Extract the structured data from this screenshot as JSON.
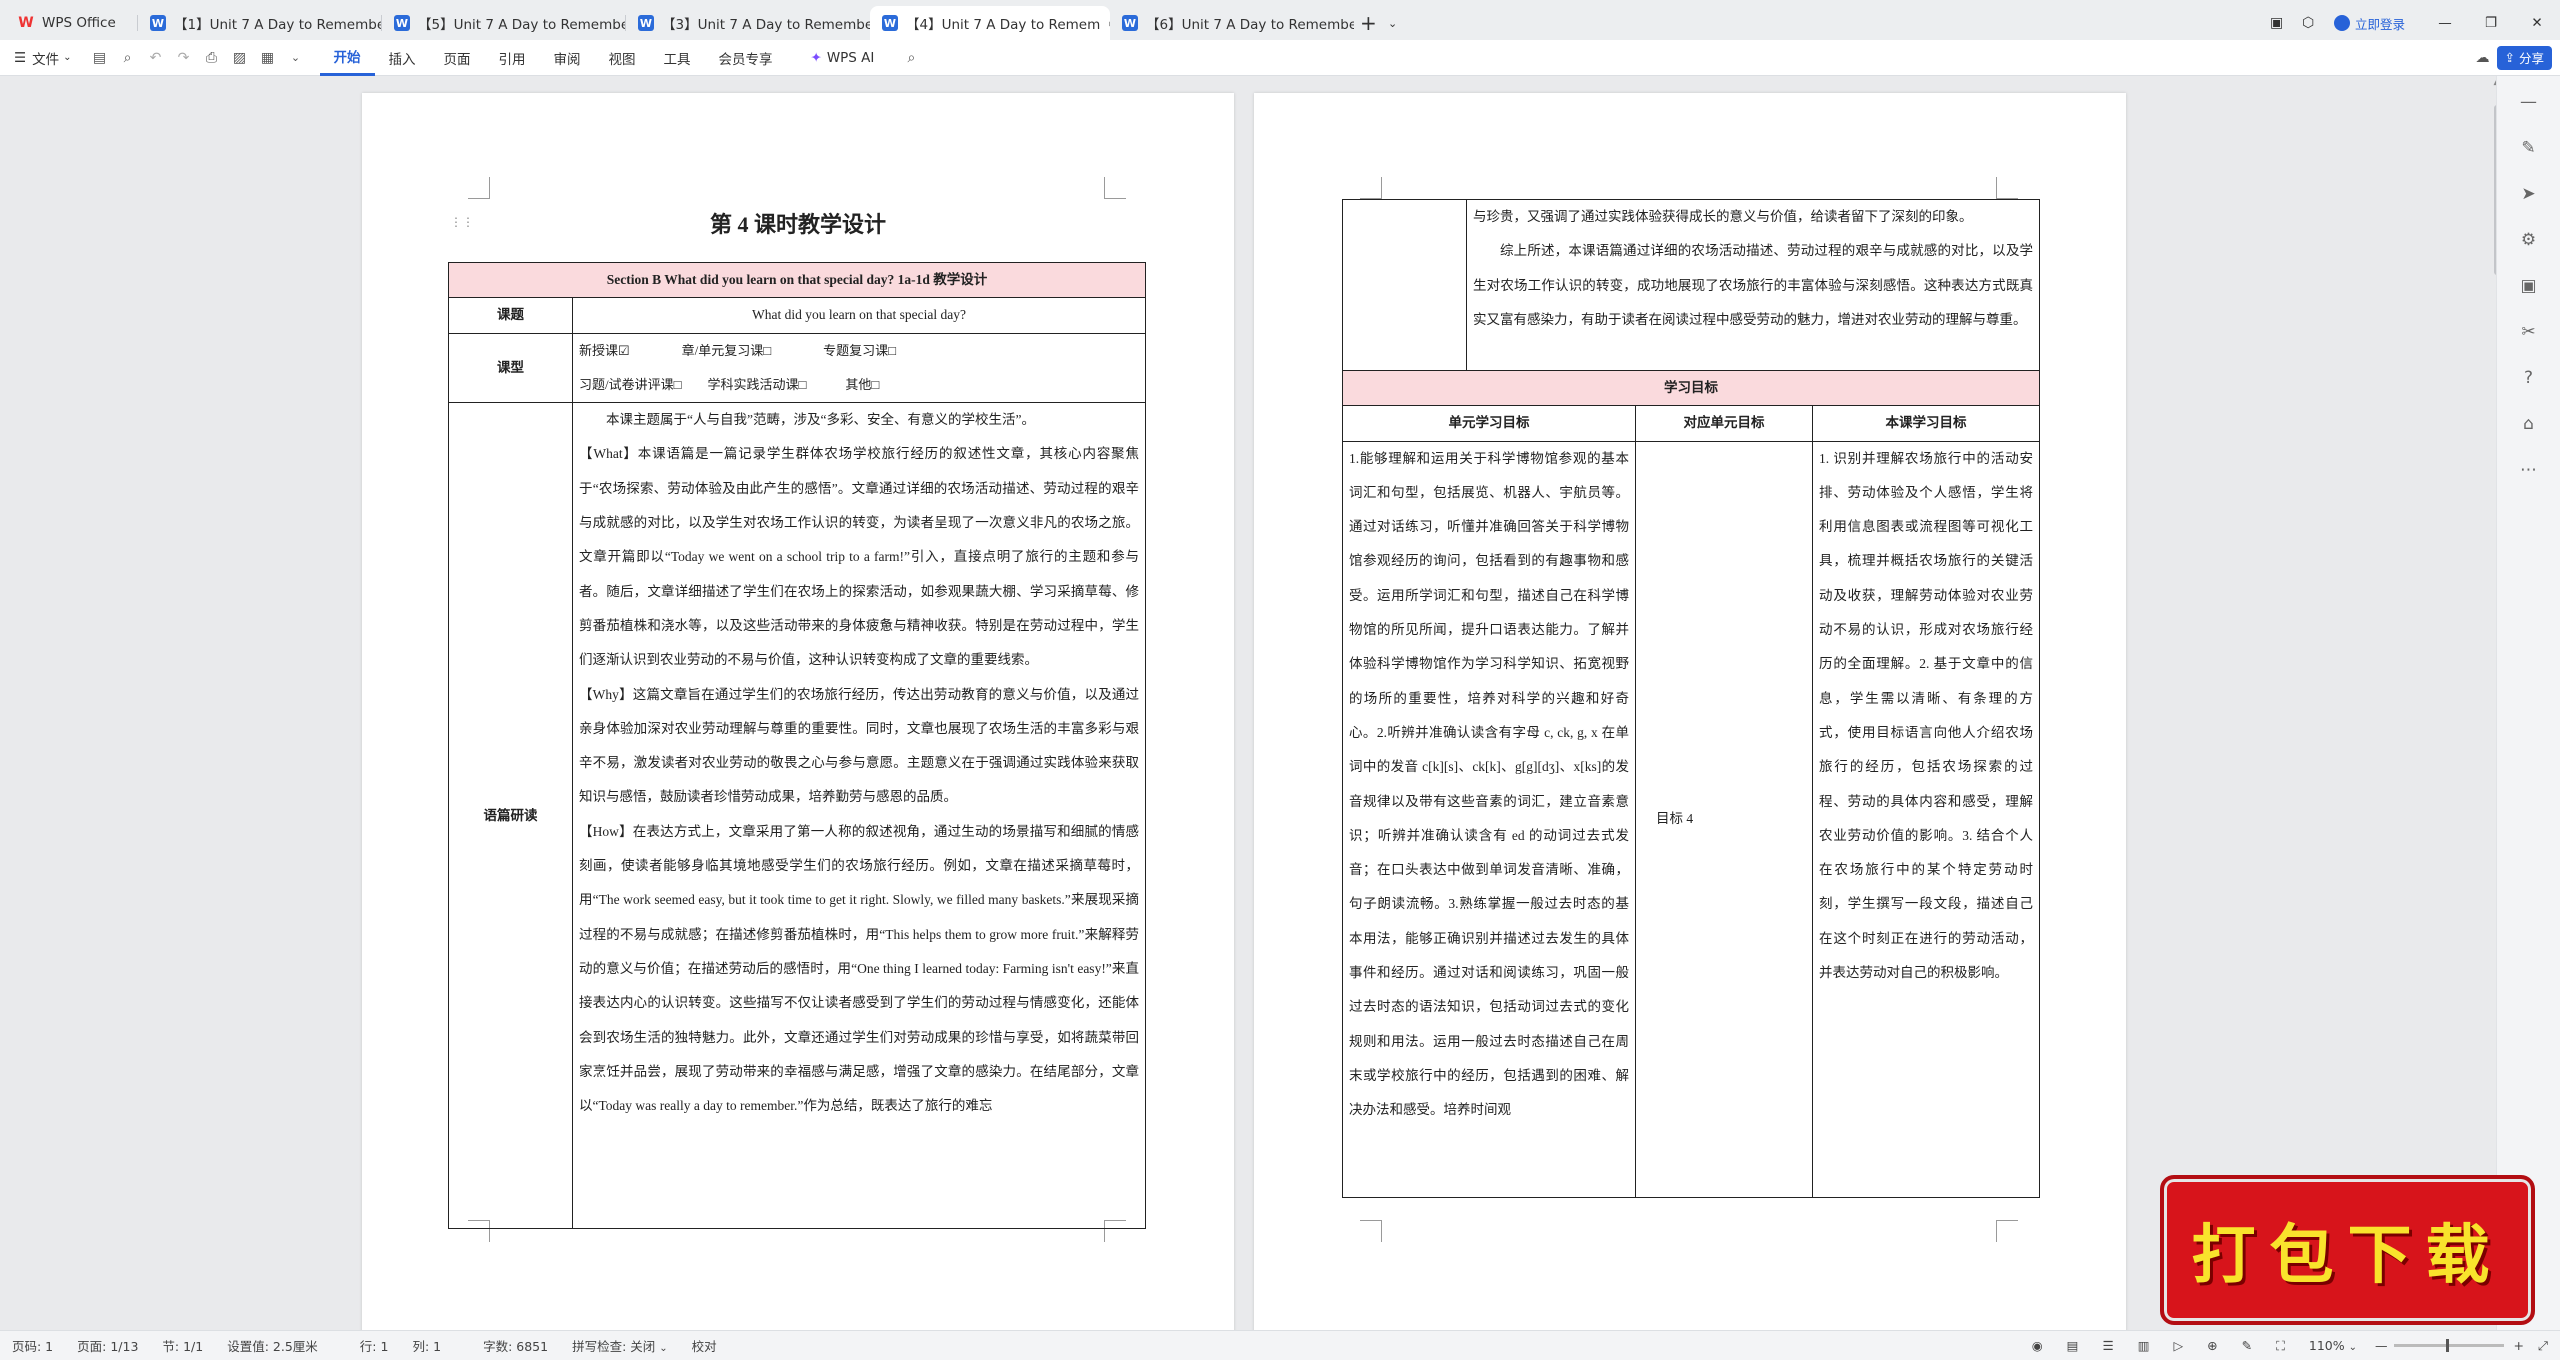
{
  "tabs": [
    {
      "label": "WPS Office",
      "kind": "wps",
      "active": false
    },
    {
      "label": "【1】Unit 7 A Day to Remember 教…",
      "kind": "w",
      "active": false
    },
    {
      "label": "【5】Unit 7 A Day to Remember 教…",
      "kind": "w",
      "active": false
    },
    {
      "label": "【3】Unit 7 A Day to Remember 教…",
      "kind": "w",
      "active": false
    },
    {
      "label": "【4】Unit 7 A Day to Remem",
      "kind": "w",
      "active": true
    },
    {
      "label": "【6】Unit 7 A Day to Remember 教…",
      "kind": "w",
      "active": false
    }
  ],
  "window": {
    "login": "立即登录",
    "add_tab": "+",
    "share": "分享"
  },
  "toolbar": {
    "file": "文件",
    "menus": [
      "开始",
      "插入",
      "页面",
      "引用",
      "审阅",
      "视图",
      "工具",
      "会员专享"
    ],
    "ai": "WPS AI"
  },
  "page1": {
    "title": "第 4 课时教学设计",
    "header": "Section B What did you learn on that special day? 1a-1d 教学设计",
    "topic_label": "课题",
    "topic_value": "What did you learn on that special day?",
    "type_label": "课型",
    "type_row1": "新授课☑　　　　章/单元复习课□　　　　专题复习课□",
    "type_row2": "习题/试卷讲评课□　　学科实践活动课□　　　其他□",
    "analysis_label": "语篇研读",
    "p_intro": "本课主题属于“人与自我”范畴，涉及“多彩、安全、有意义的学校生活”。",
    "p_what": "【What】本课语篇是一篇记录学生群体农场学校旅行经历的叙述性文章，其核心内容聚焦于“农场探索、劳动体验及由此产生的感悟”。文章通过详细的农场活动描述、劳动过程的艰辛与成就感的对比，以及学生对农场工作认识的转变，为读者呈现了一次意义非凡的农场之旅。文章开篇即以“Today we went on a school trip to a farm!”引入，直接点明了旅行的主题和参与者。随后，文章详细描述了学生们在农场上的探索活动，如参观果蔬大棚、学习采摘草莓、修剪番茄植株和浇水等，以及这些活动带来的身体疲惫与精神收获。特别是在劳动过程中，学生们逐渐认识到农业劳动的不易与价值，这种认识转变构成了文章的重要线索。",
    "p_why": "【Why】这篇文章旨在通过学生们的农场旅行经历，传达出劳动教育的意义与价值，以及通过亲身体验加深对农业劳动理解与尊重的重要性。同时，文章也展现了农场生活的丰富多彩与艰辛不易，激发读者对农业劳动的敬畏之心与参与意愿。主题意义在于强调通过实践体验来获取知识与感悟，鼓励读者珍惜劳动成果，培养勤劳与感恩的品质。",
    "p_how": "【How】在表达方式上，文章采用了第一人称的叙述视角，通过生动的场景描写和细腻的情感刻画，使读者能够身临其境地感受学生们的农场旅行经历。例如，文章在描述采摘草莓时，用“The work seemed easy, but it took time to get it right. Slowly, we filled many baskets.”来展现采摘过程的不易与成就感；在描述修剪番茄植株时，用“This helps them to grow more fruit.”来解释劳动的意义与价值；在描述劳动后的感悟时，用“One thing I learned today: Farming isn't easy!”来直接表达内心的认识转变。这些描写不仅让读者感受到了学生们的劳动过程与情感变化，还能体会到农场生活的独特魅力。此外，文章还通过学生们对劳动成果的珍惜与享受，如将蔬菜带回家烹饪并品尝，展现了劳动带来的幸福感与满足感，增强了文章的感染力。在结尾部分，文章以“Today was really a day to remember.”作为总结，既表达了旅行的难忘"
  },
  "page2": {
    "cont1": "与珍贵，又强调了通过实践体验获得成长的意义与价值，给读者留下了深刻的印象。",
    "cont2": "综上所述，本课语篇通过详细的农场活动描述、劳动过程的艰辛与成就感的对比，以及学生对农场工作认识的转变，成功地展现了农场旅行的丰富体验与深刻感悟。这种表达方式既真实又富有感染力，有助于读者在阅读过程中感受劳动的魅力，增进对农业劳动的理解与尊重。",
    "goals_title": "学习目标",
    "col_unit": "单元学习目标",
    "col_match": "对应单元目标",
    "col_lesson": "本课学习目标",
    "unit_goals": "1.能够理解和运用关于科学博物馆参观的基本词汇和句型，包括展览、机器人、宇航员等。通过对话练习，听懂并准确回答关于科学博物馆参观经历的询问，包括看到的有趣事物和感受。运用所学词汇和句型，描述自己在科学博物馆的所见所闻，提升口语表达能力。了解并体验科学博物馆作为学习科学知识、拓宽视野的场所的重要性，培养对科学的兴趣和好奇心。2.听辨并准确认读含有字母 c, ck, g, x 在单词中的发音 c[k][s]、ck[k]、g[g][dʒ]、x[ks]的发音规律以及带有这些音素的词汇，建立音素意识；听辨并准确认读含有 ed 的动词过去式发音；在口头表达中做到单词发音清晰、准确，句子朗读流畅。3.熟练掌握一般过去时态的基本用法，能够正确识别并描述过去发生的具体事件和经历。通过对话和阅读练习，巩固一般过去时态的语法知识，包括动词过去式的变化规则和用法。运用一般过去时态描述自己在周末或学校旅行中的经历，包括遇到的困难、解决办法和感受。培养时间观",
    "match": "目标 4",
    "lesson_goals": "1. 识别并理解农场旅行中的活动安排、劳动体验及个人感悟，学生将利用信息图表或流程图等可视化工具，梳理并概括农场旅行的关键活动及收获，理解劳动体验对农业劳动不易的认识，形成对农场旅行经历的全面理解。2. 基于文章中的信息，学生需以清晰、有条理的方式，使用目标语言向他人介绍农场旅行的经历，包括农场探索的过程、劳动的具体内容和感受，理解农业劳动价值的影响。3. 结合个人在农场旅行中的某个特定劳动时刻，学生撰写一段文段，描述自己在这个时刻正在进行的劳动活动，并表达劳动对自己的积极影响。"
  },
  "status": {
    "page_code": "页码: 1",
    "pages": "页面: 1/13",
    "section": "节: 1/1",
    "set": "设置值: 2.5厘米",
    "row": "行: 1",
    "col": "列: 1",
    "words": "字数: 6851",
    "spell": "拼写检查: 关闭",
    "proof": "校对",
    "zoom": "110%"
  },
  "promo": {
    "text": "打包下载"
  }
}
